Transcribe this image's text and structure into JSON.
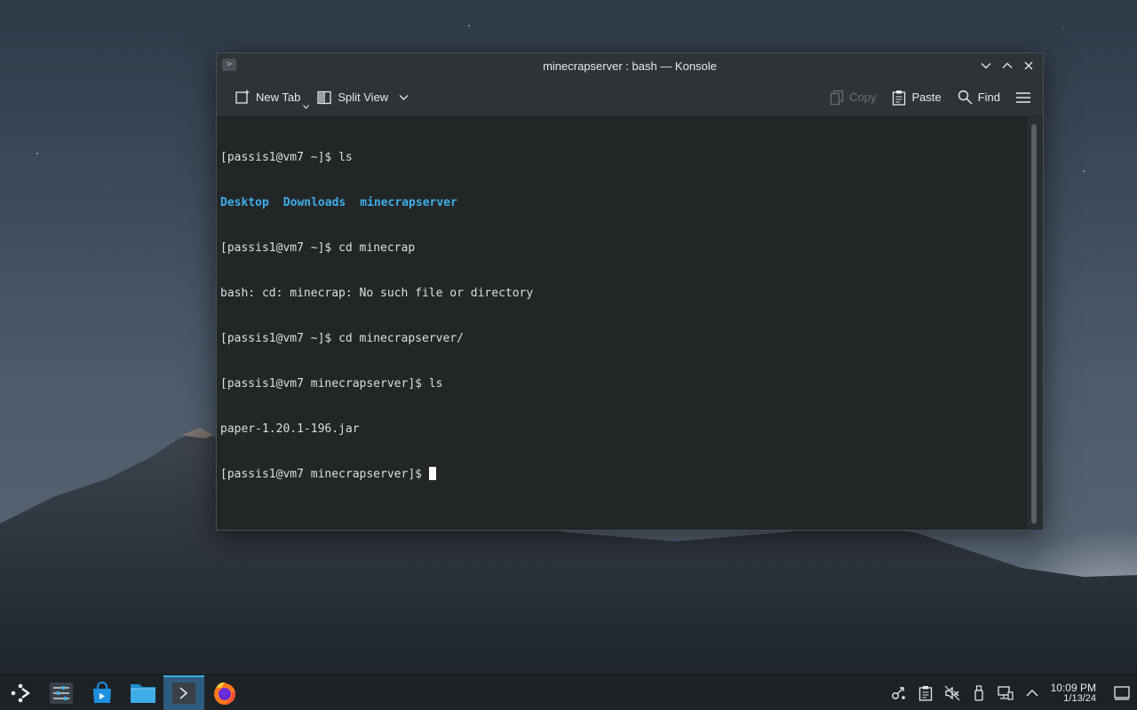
{
  "window": {
    "title": "minecrapserver : bash — Konsole",
    "app_icon_glyph": ">",
    "controls": [
      "minimize",
      "maximize",
      "close"
    ]
  },
  "toolbar": {
    "new_tab_label": "New Tab",
    "split_view_label": "Split View",
    "copy_label": "Copy",
    "paste_label": "Paste",
    "find_label": "Find"
  },
  "terminal": {
    "lines": [
      {
        "prompt": "[passis1@vm7 ~]$ ",
        "command": "ls"
      },
      {
        "dirs": [
          "Desktop",
          "Downloads",
          "minecrapserver"
        ]
      },
      {
        "prompt": "[passis1@vm7 ~]$ ",
        "command": "cd minecrap"
      },
      {
        "output": "bash: cd: minecrap: No such file or directory"
      },
      {
        "prompt": "[passis1@vm7 ~]$ ",
        "command": "cd minecrapserver/"
      },
      {
        "prompt": "[passis1@vm7 minecrapserver]$ ",
        "command": "ls"
      },
      {
        "output": "paper-1.20.1-196.jar"
      },
      {
        "prompt": "[passis1@vm7 minecrapserver]$ ",
        "command": ""
      }
    ],
    "colors": {
      "background": "#232627",
      "text": "#dcdfe2",
      "directory": "#3daee9"
    }
  },
  "taskbar": {
    "launchers": [
      "application-launcher",
      "system-settings",
      "discover",
      "dolphin-file-manager",
      "konsole",
      "firefox"
    ],
    "clock": {
      "time": "10:09 PM",
      "date": "1/13/24"
    }
  }
}
